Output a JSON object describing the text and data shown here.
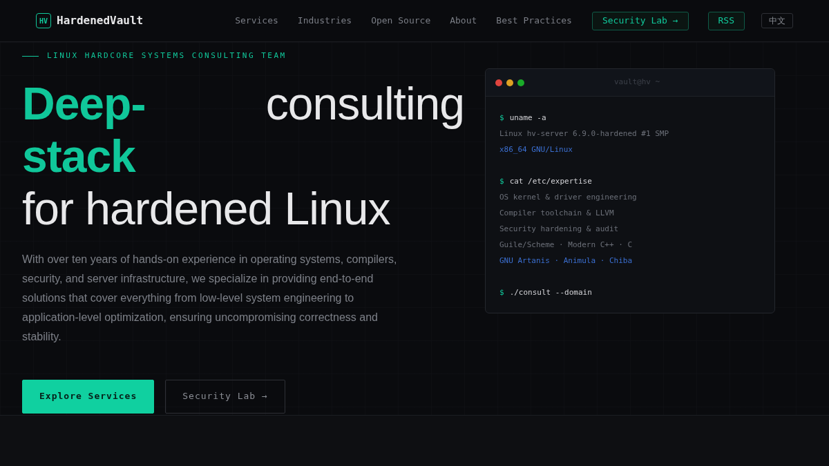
{
  "brand": {
    "logo": "HV",
    "name": "HardenedVault"
  },
  "nav": {
    "links": [
      "Services",
      "Industries",
      "Open Source",
      "About",
      "Best Practices"
    ],
    "cta": "Security Lab →",
    "rss": "RSS",
    "language": "中文"
  },
  "hero": {
    "eyebrow": "LINUX HARDCORE SYSTEMS CONSULTING TEAM",
    "title_accent": "Deep-stack",
    "title_rest": "consulting",
    "title_line2": "for hardened Linux",
    "description": "With over ten years of hands-on experience in operating systems, compilers, security, and server infrastructure, we specialize in providing end-to-end solutions that cover everything from low-level system engineering to application-level optimization, ensuring uncompromising correctness and stability.",
    "buttons": [
      {
        "label": "Explore Services",
        "kind": "primary"
      },
      {
        "label": "Security Lab →",
        "kind": "secondary"
      }
    ]
  },
  "terminal": {
    "title": "vault@hv ~",
    "lines": [
      {
        "kind": "command",
        "prompt": "$",
        "text": "uname -a"
      },
      {
        "kind": "output",
        "text": "Linux hv-server 6.9.0-hardened #1 SMP"
      },
      {
        "kind": "highlight",
        "text": "x86_64 GNU/Linux"
      },
      {
        "kind": "blank"
      },
      {
        "kind": "command",
        "prompt": "$",
        "text": "cat /etc/expertise"
      },
      {
        "kind": "output",
        "text": "OS kernel & driver engineering"
      },
      {
        "kind": "output",
        "text": "Compiler toolchain & LLVM"
      },
      {
        "kind": "output",
        "text": "Security hardening & audit"
      },
      {
        "kind": "output",
        "text": "Guile/Scheme · Modern C++ · C"
      },
      {
        "kind": "highlight",
        "text": "GNU Artanis · Animula · Chiba"
      },
      {
        "kind": "blank"
      },
      {
        "kind": "command",
        "prompt": "$",
        "text": "./consult --domain"
      }
    ]
  }
}
